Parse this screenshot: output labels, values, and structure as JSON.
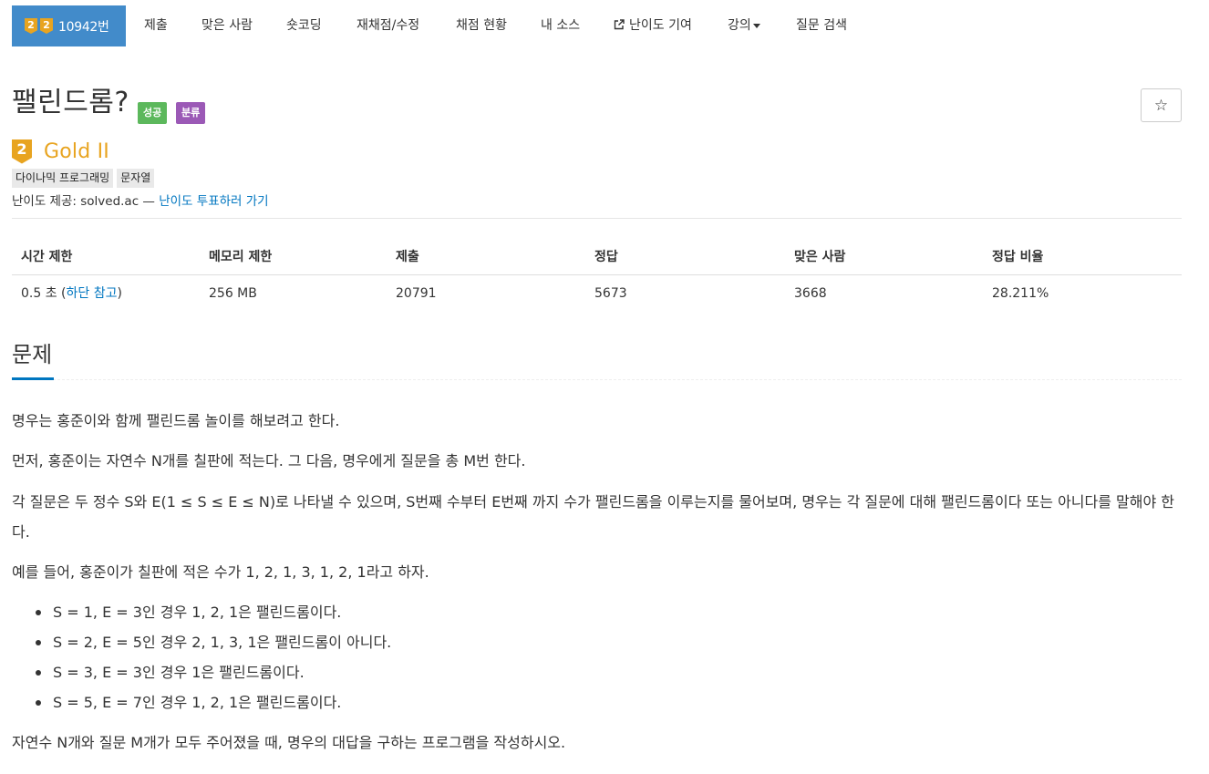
{
  "nav": {
    "brand": {
      "tier_digits": [
        "2",
        "2"
      ],
      "problem_number": "10942번"
    },
    "items": [
      {
        "label": "제출"
      },
      {
        "label": "맞은 사람"
      },
      {
        "label": "숏코딩"
      },
      {
        "label": "재채점/수정"
      },
      {
        "label": "채점 현황"
      },
      {
        "label": "내 소스"
      },
      {
        "label": "난이도 기여",
        "icon": "external-link-icon"
      },
      {
        "label": "강의",
        "icon": "caret-down-icon"
      },
      {
        "label": "질문 검색"
      }
    ]
  },
  "problem": {
    "title": "팰린드롬?",
    "labels": {
      "success": "성공",
      "classification": "분류"
    },
    "star_icon": "☆",
    "tier": {
      "digit": "2",
      "name": "Gold II",
      "color": "#e8a420"
    },
    "tags": [
      "다이나믹 프로그래밍",
      "문자열"
    ],
    "source": {
      "prefix": "난이도 제공: solved.ac — ",
      "link": "난이도 투표하러 가기"
    }
  },
  "info": {
    "headers": [
      "시간 제한",
      "메모리 제한",
      "제출",
      "정답",
      "맞은 사람",
      "정답 비율"
    ],
    "time_limit": {
      "value": "0.5 초 (",
      "link": "하단 참고",
      "suffix": ")"
    },
    "values": [
      "256 MB",
      "20791",
      "5673",
      "3668",
      "28.211%"
    ]
  },
  "description": {
    "heading": "문제",
    "paragraphs": [
      "명우는 홍준이와 함께 팰린드롬 놀이를 해보려고 한다.",
      "먼저, 홍준이는 자연수 N개를 칠판에 적는다. 그 다음, 명우에게 질문을 총 M번 한다.",
      "각 질문은 두 정수 S와 E(1 ≤ S ≤ E ≤ N)로 나타낼 수 있으며, S번째 수부터 E번째 까지 수가 팰린드롬을 이루는지를 물어보며, 명우는 각 질문에 대해 팰린드롬이다 또는 아니다를 말해야 한다.",
      "예를 들어, 홍준이가 칠판에 적은 수가 1, 2, 1, 3, 1, 2, 1라고 하자."
    ],
    "examples": [
      "S = 1, E = 3인 경우 1, 2, 1은 팰린드롬이다.",
      "S = 2, E = 5인 경우 2, 1, 3, 1은 팰린드롬이 아니다.",
      "S = 3, E = 3인 경우 1은 팰린드롬이다.",
      "S = 5, E = 7인 경우 1, 2, 1은 팰린드롬이다."
    ],
    "closing": "자연수 N개와 질문 M개가 모두 주어졌을 때, 명우의 대답을 구하는 프로그램을 작성하시오."
  },
  "colors": {
    "brand": "#428bca",
    "link": "#0076c0",
    "success": "#5cb85c",
    "classification": "#9b59b6",
    "gold_tier": "#e8a420"
  }
}
